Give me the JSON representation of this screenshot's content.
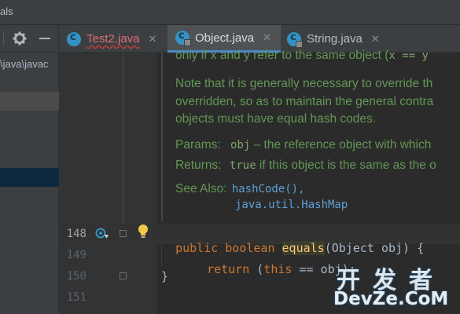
{
  "window": {
    "title": "als"
  },
  "project_panel": {
    "path_fragment": "\\java\\javac"
  },
  "tabs": [
    {
      "label": "Test2.java",
      "close": "✕",
      "state": "error"
    },
    {
      "label": "Object.java",
      "close": "✕",
      "state": "active"
    },
    {
      "label": "String.java",
      "close": "✕",
      "state": "inactive"
    }
  ],
  "doc": {
    "line1_a": "only if x and y refer to the same object (",
    "line1_code": "x == y",
    "line2": "Note that it is generally necessary to override th",
    "line3": "overridden, so as to maintain the general contra",
    "line4": "objects must have equal hash codes.",
    "params_label": "Params:",
    "params_code": "obj",
    "params_text": " – the reference object with which",
    "returns_label": "Returns:",
    "returns_code": "true",
    "returns_text": " if this object is the same as the o",
    "seealso_label": "See Also:",
    "seealso_link1": "hashCode(),",
    "seealso_link2": "java.util.HashMap"
  },
  "code": {
    "line_numbers": [
      "148",
      "149",
      "150",
      "151"
    ],
    "line148": {
      "kw1": "public",
      "kw2": "boolean",
      "fn": "equals",
      "rest": "(Object obj) {"
    },
    "line149": {
      "kw": "return",
      "open": " (",
      "this": "this",
      "rest": " == obj);"
    },
    "line150": {
      "text": "}"
    }
  },
  "watermark": {
    "cn": "开发者",
    "en": "DevZe.CoM"
  },
  "colors": {
    "editor_bg": "#2b2b2b",
    "keyword": "#cc7832",
    "method": "#ffc66d",
    "doc_text": "#629755",
    "link": "#5c9fd6"
  },
  "icons": [
    "gear-icon",
    "minus-icon",
    "java-class-icon",
    "close-icon",
    "override-icon",
    "lightbulb-icon",
    "fold-icon"
  ]
}
